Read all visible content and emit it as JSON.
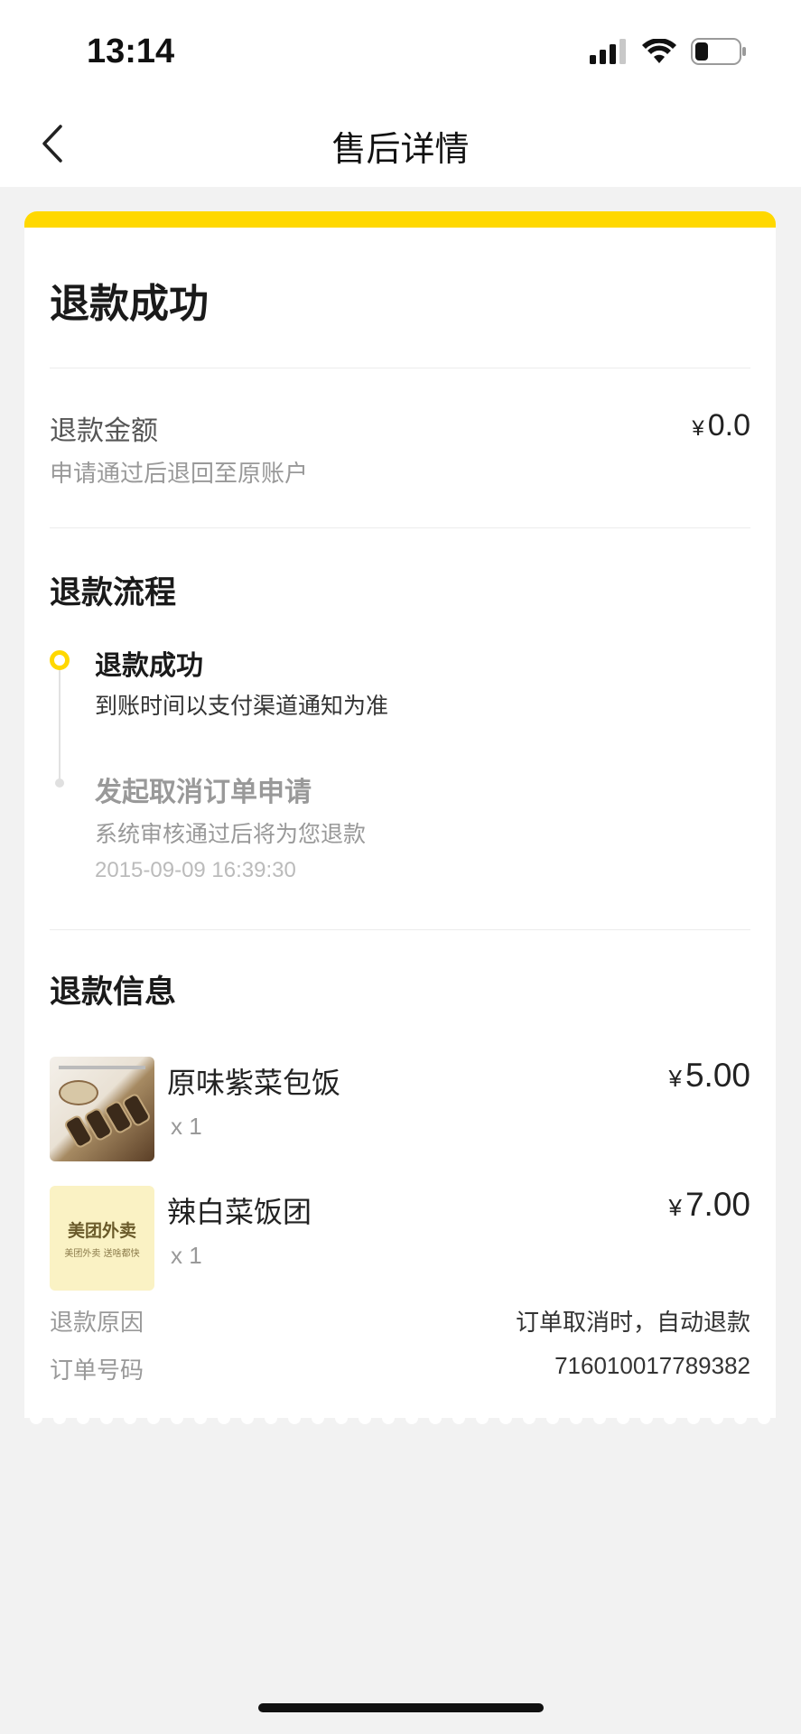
{
  "status_bar": {
    "time": "13:14"
  },
  "nav": {
    "title": "售后详情"
  },
  "refund": {
    "status": "退款成功",
    "amount_label": "退款金额",
    "amount_currency": "¥",
    "amount_value": "0.0",
    "amount_note": "申请通过后退回至原账户"
  },
  "process": {
    "title": "退款流程",
    "steps": [
      {
        "title": "退款成功",
        "desc": "到账时间以支付渠道通知为准"
      },
      {
        "title": "发起取消订单申请",
        "desc": "系统审核通过后将为您退款",
        "time": "2015-09-09 16:39:30"
      }
    ]
  },
  "info": {
    "title": "退款信息",
    "items": [
      {
        "name": "原味紫菜包饭",
        "qty": "x 1",
        "currency": "¥",
        "price": "5.00"
      },
      {
        "name": "辣白菜饭团",
        "qty": "x 1",
        "currency": "¥",
        "price": "7.00",
        "thumb_logo": "美团外卖",
        "thumb_sub": "美团外卖  送啥都快"
      }
    ],
    "reason_label": "退款原因",
    "reason_value": "订单取消时，自动退款",
    "order_label": "订单号码",
    "order_value": "716010017789382"
  },
  "colors": {
    "accent": "#ffd800",
    "background": "#f2f2f2"
  }
}
